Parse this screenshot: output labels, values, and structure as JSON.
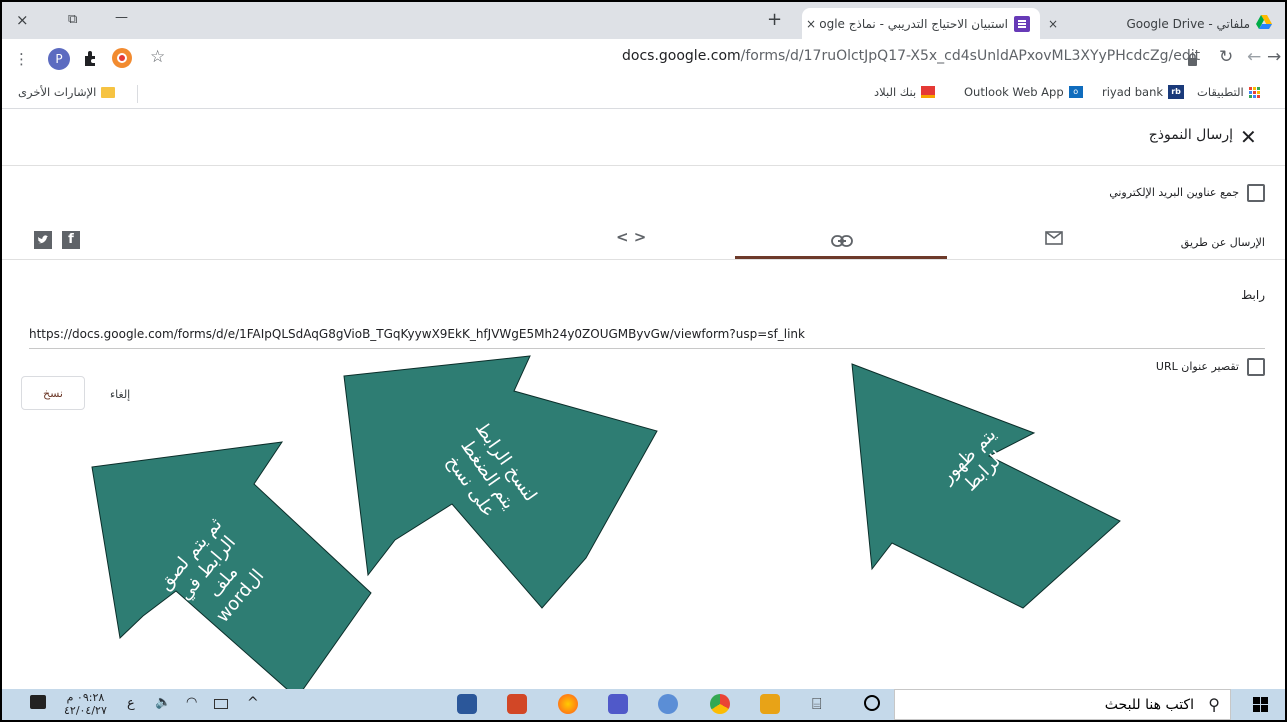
{
  "browser": {
    "tabs": [
      {
        "title": "ملفاتي - Google Drive",
        "close": "×"
      },
      {
        "title": "استبيان الاحتياج التدريبي - نماذج Google",
        "close": "×"
      }
    ],
    "new_tab": "+",
    "window_close": "×",
    "window_restore": "⧉",
    "window_minimize": "—",
    "url_host": "docs.google.com",
    "url_path": "/forms/d/17ruOlctJpQ17-X5x_cd4sUnldAPxovML3XYyPHcdcZg/edit",
    "profile_initial": "P",
    "bookmarks": [
      {
        "label": "التطبيقات"
      },
      {
        "label": "riyad bank"
      },
      {
        "label": "Outlook Web App"
      },
      {
        "label": "بنك البلاد"
      }
    ],
    "other_bookmarks": "الإشارات الأخرى"
  },
  "dialog": {
    "title": "إرسال النموذج",
    "collect_emails": "جمع عناوين البريد الإلكتروني",
    "send_via": "الإرسال عن طريق",
    "link_heading": "رابط",
    "link_url": "https://docs.google.com/forms/d/e/1FAIpQLSdAqG8gVioB_TGqKyywX9EkK_hfJVWgE5Mh24y0ZOUGMByvGw/viewform?usp=sf_link",
    "shorten_url": "تقصير عنوان URL",
    "cancel": "إلغاء",
    "copy": "نسخ"
  },
  "annotations": {
    "arrow_right": [
      "يتم ظهور",
      "الرابط"
    ],
    "arrow_middle": [
      "لنسخ الرابط",
      "يتم الضغط",
      "على نسخ"
    ],
    "arrow_left": [
      "ثم يتم لصق",
      "الرابط في",
      "ملف",
      "الword"
    ],
    "arrow_color": "#2e7d73"
  },
  "taskbar": {
    "search_placeholder": "اكتب هنا للبحث",
    "time": "٠٩:٢٨ م",
    "date": "٤٢/٠٤/٢٧",
    "language": "ع"
  }
}
